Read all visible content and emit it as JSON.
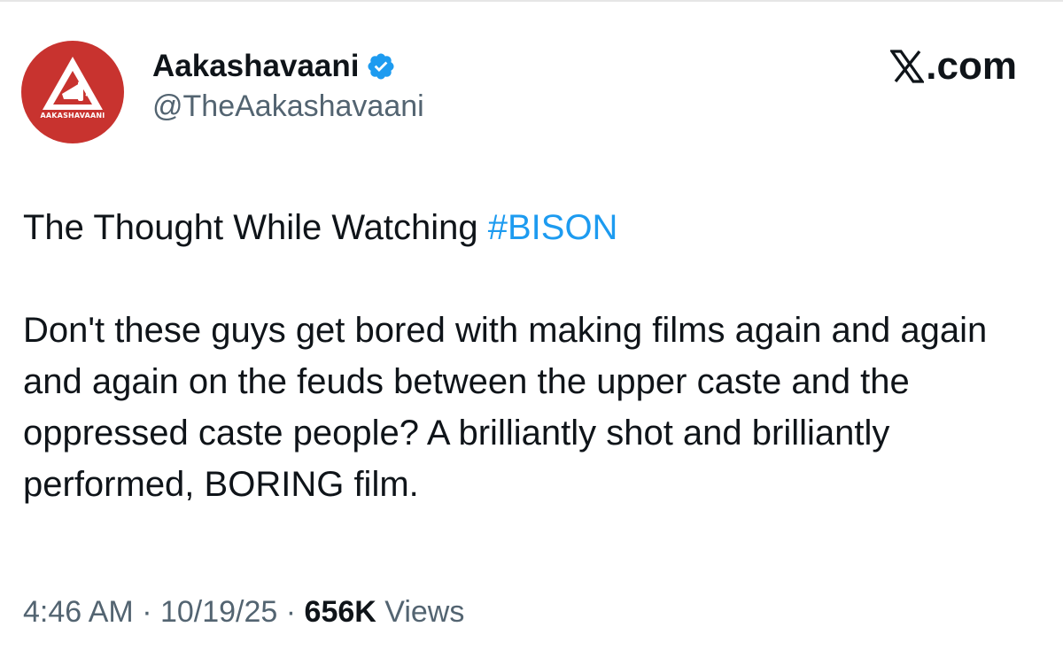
{
  "author": {
    "display_name": "Aakashavaani",
    "handle": "@TheAakashavaani",
    "avatar_text": "AAKASHAVAANI",
    "verified": true,
    "avatar_color": "#c8332f",
    "verified_color": "#1d9bf0"
  },
  "brand": {
    "label": ".com",
    "icon": "x-logo-icon"
  },
  "tweet": {
    "line1_prefix": "The Thought While Watching ",
    "hashtag": "#BISON",
    "body": "Don't these guys get bored with making films again and again and again on the feuds between the upper caste and the oppressed caste people? A brilliantly shot and brilliantly performed, BORING film."
  },
  "meta": {
    "time": "4:46 AM",
    "separator": " · ",
    "date": "10/19/25",
    "views_count": "656K",
    "views_label": " Views"
  },
  "colors": {
    "text": "#0f1419",
    "secondary": "#536471",
    "link": "#1d9bf0"
  }
}
